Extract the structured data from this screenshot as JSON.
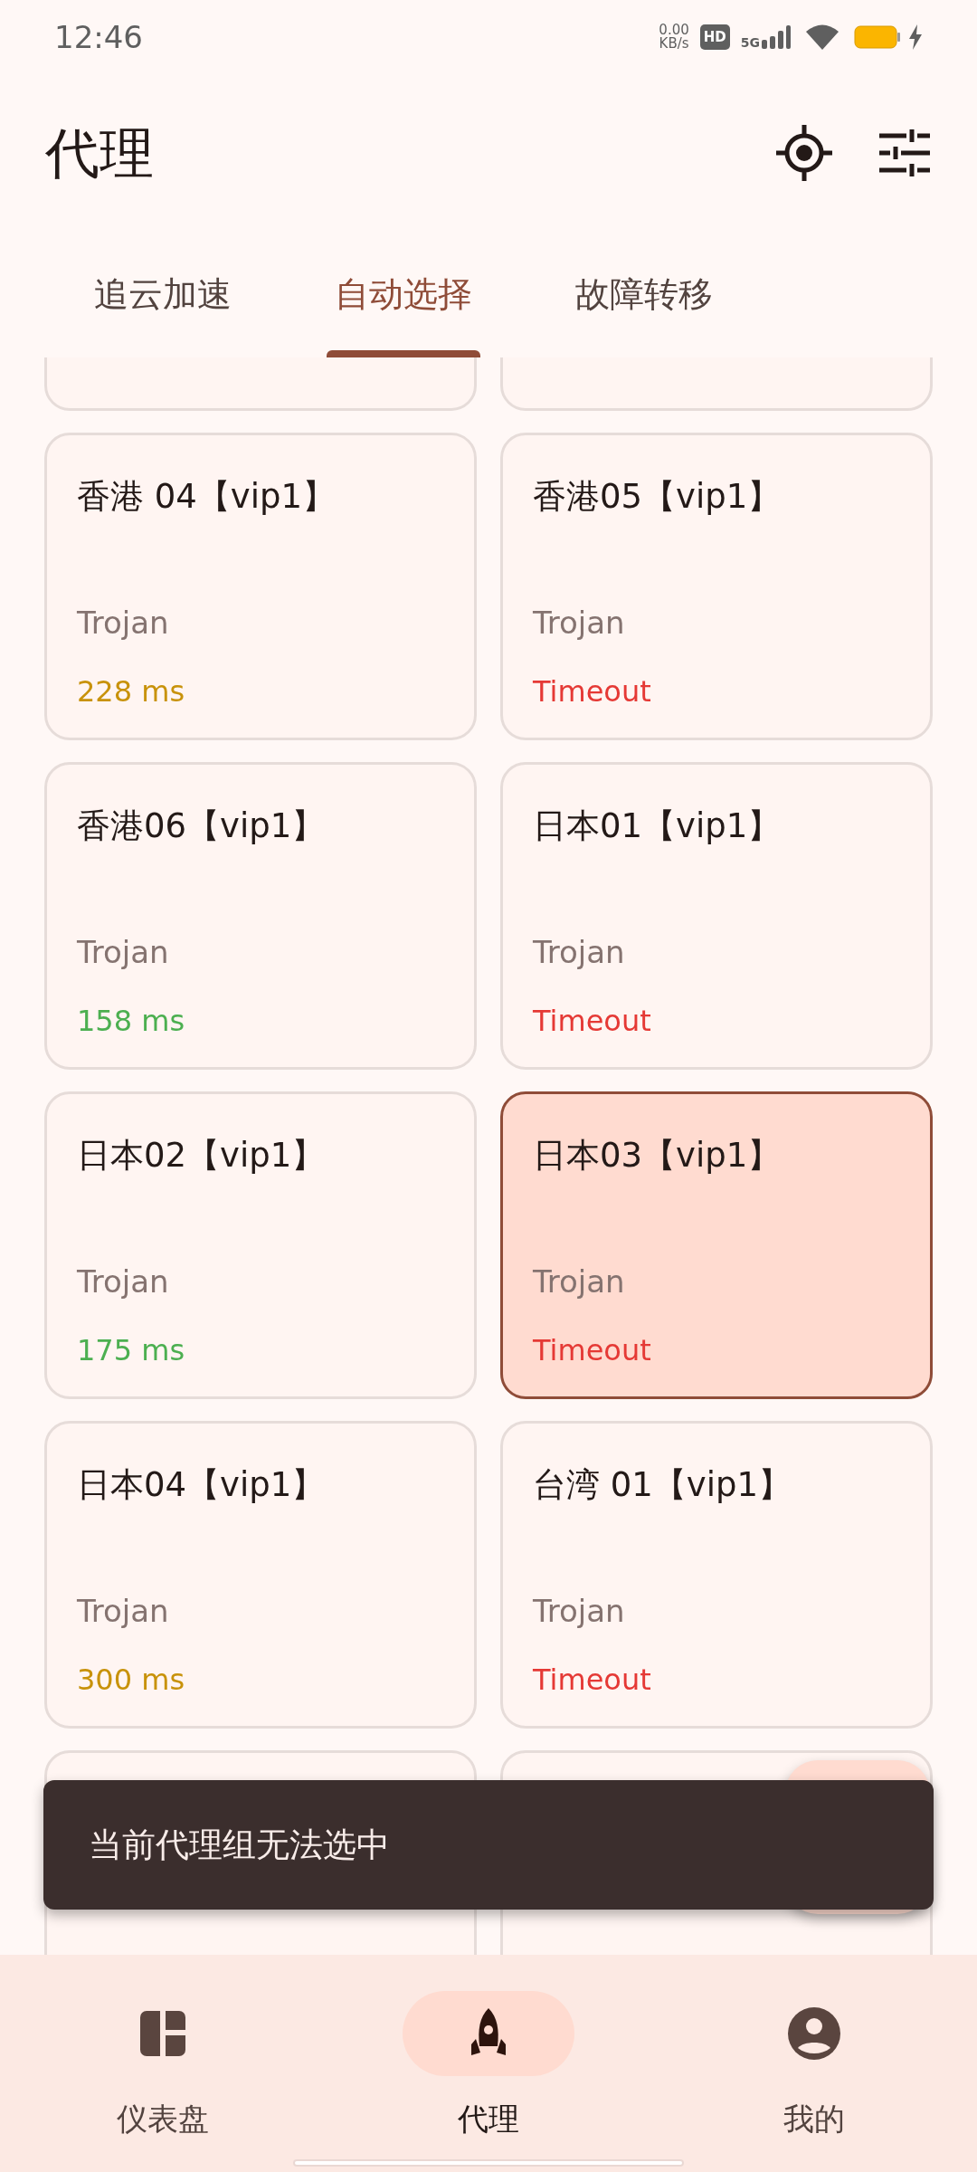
{
  "status_bar": {
    "time": "12:46",
    "net_speed": "0.00",
    "net_unit": "KB/s",
    "hd": "HD",
    "network": "5G"
  },
  "header": {
    "title": "代理"
  },
  "tabs": [
    {
      "label": "追云加速",
      "selected": false
    },
    {
      "label": "自动选择",
      "selected": true
    },
    {
      "label": "故障转移",
      "selected": false
    }
  ],
  "proxies": [
    {
      "name": "香港 04【vip1】",
      "type": "Trojan",
      "delay": "228 ms",
      "color": "#c8920a",
      "selected": false
    },
    {
      "name": "香港05【vip1】",
      "type": "Trojan",
      "delay": "Timeout",
      "color": "#e53935",
      "selected": false
    },
    {
      "name": "香港06【vip1】",
      "type": "Trojan",
      "delay": "158 ms",
      "color": "#4caf50",
      "selected": false
    },
    {
      "name": "日本01【vip1】",
      "type": "Trojan",
      "delay": "Timeout",
      "color": "#e53935",
      "selected": false
    },
    {
      "name": "日本02【vip1】",
      "type": "Trojan",
      "delay": "175 ms",
      "color": "#4caf50",
      "selected": false
    },
    {
      "name": "日本03【vip1】",
      "type": "Trojan",
      "delay": "Timeout",
      "color": "#e53935",
      "selected": true
    },
    {
      "name": "日本04【vip1】",
      "type": "Trojan",
      "delay": "300 ms",
      "color": "#c8920a",
      "selected": false
    },
    {
      "name": "台湾 01【vip1】",
      "type": "Trojan",
      "delay": "Timeout",
      "color": "#e53935",
      "selected": false
    }
  ],
  "snackbar": {
    "message": "当前代理组无法选中"
  },
  "bottom_nav": [
    {
      "label": "仪表盘",
      "selected": false
    },
    {
      "label": "代理",
      "selected": true
    },
    {
      "label": "我的",
      "selected": false
    }
  ]
}
